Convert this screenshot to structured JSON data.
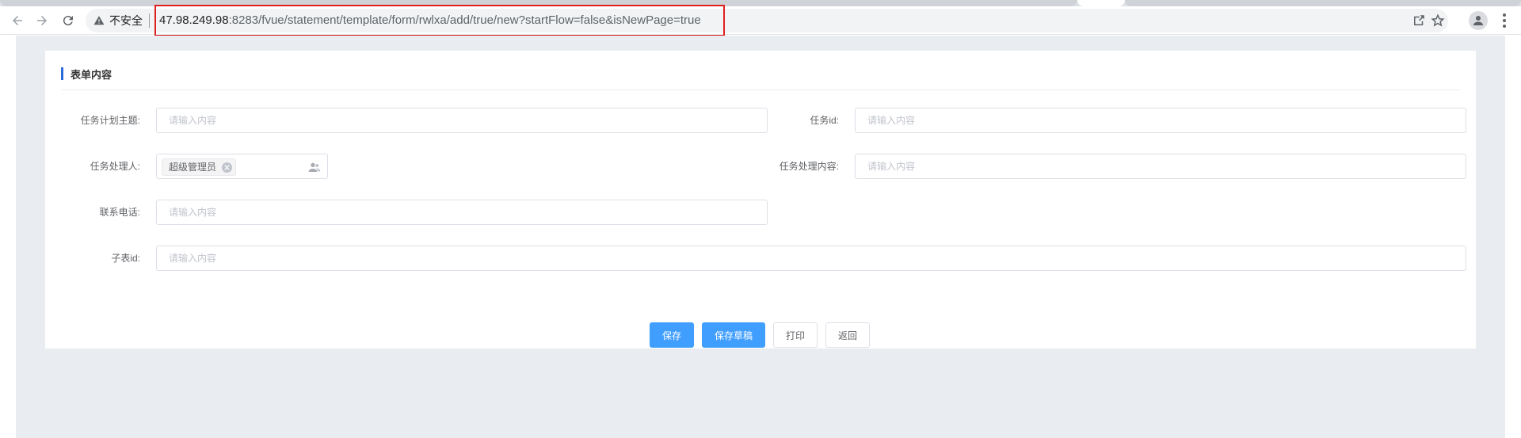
{
  "browser": {
    "security_label": "不安全",
    "url_host": "47.98.249.98",
    "url_rest": ":8283/fvue/statement/template/form/rwlxa/add/true/new?startFlow=false&isNewPage=true"
  },
  "form": {
    "section_title": "表单内容",
    "fields": {
      "task_plan_subject": {
        "label": "任务计划主题:",
        "value": "",
        "placeholder": "请输入内容"
      },
      "task_id": {
        "label": "任务id:",
        "value": "",
        "placeholder": "请输入内容"
      },
      "task_handler": {
        "label": "任务处理人:",
        "selected": "超级管理员"
      },
      "task_handling_content": {
        "label": "任务处理内容:",
        "value": "",
        "placeholder": "请输入内容"
      },
      "contact_phone": {
        "label": "联系电话:",
        "value": "",
        "placeholder": "请输入内容"
      },
      "sub_table_id": {
        "label": "子表id:",
        "value": "",
        "placeholder": "请输入内容"
      }
    }
  },
  "actions": {
    "save": "保存",
    "save_draft": "保存草稿",
    "print": "打印",
    "back": "返回"
  },
  "colors": {
    "primary": "#409eff",
    "accent_bar": "#2b6bd8",
    "url_highlight": "#e02020",
    "page_bg": "#e9edf2"
  },
  "icons": [
    "back-arrow-icon",
    "forward-arrow-icon",
    "reload-icon",
    "warning-icon",
    "share-icon",
    "star-icon",
    "profile-icon",
    "menu-icon",
    "clear-tag-icon",
    "people-selector-icon"
  ]
}
